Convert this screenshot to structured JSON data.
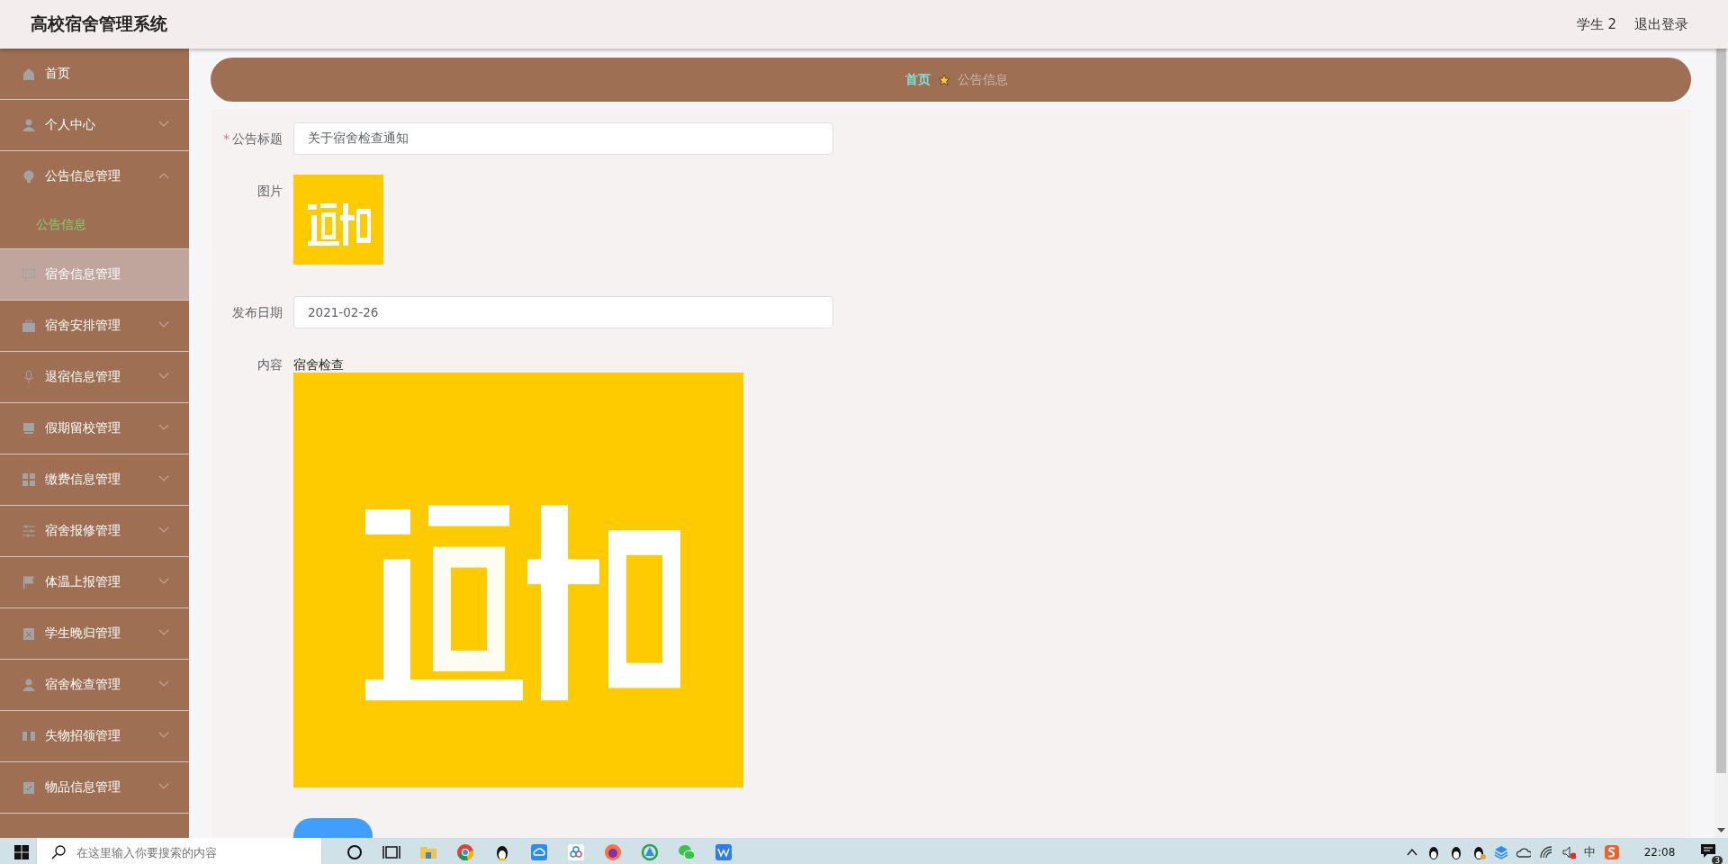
{
  "header": {
    "title": "高校宿舍管理系统",
    "user": "学生 2",
    "logout": "退出登录"
  },
  "sidebar": {
    "items": [
      {
        "kind": "link",
        "label": "首页",
        "hovered": false
      },
      {
        "kind": "menu",
        "label": "个人中心",
        "expanded": false,
        "hovered": false
      },
      {
        "kind": "menu",
        "label": "公告信息管理",
        "expanded": true,
        "hovered": false,
        "children": [
          {
            "label": "公告信息",
            "selected": true
          }
        ]
      },
      {
        "kind": "menu",
        "label": "宿舍信息管理",
        "expanded": false,
        "hovered": true
      },
      {
        "kind": "menu",
        "label": "宿舍安排管理",
        "expanded": false,
        "hovered": false
      },
      {
        "kind": "menu",
        "label": "退宿信息管理",
        "expanded": false,
        "hovered": false
      },
      {
        "kind": "menu",
        "label": "假期留校管理",
        "expanded": false,
        "hovered": false
      },
      {
        "kind": "menu",
        "label": "缴费信息管理",
        "expanded": false,
        "hovered": false
      },
      {
        "kind": "menu",
        "label": "宿舍报修管理",
        "expanded": false,
        "hovered": false
      },
      {
        "kind": "menu",
        "label": "体温上报管理",
        "expanded": false,
        "hovered": false
      },
      {
        "kind": "menu",
        "label": "学生晚归管理",
        "expanded": false,
        "hovered": false
      },
      {
        "kind": "menu",
        "label": "宿舍检查管理",
        "expanded": false,
        "hovered": false
      },
      {
        "kind": "menu",
        "label": "失物招领管理",
        "expanded": false,
        "hovered": false
      },
      {
        "kind": "menu",
        "label": "物品信息管理",
        "expanded": false,
        "hovered": false
      }
    ]
  },
  "breadcrumb": [
    {
      "label": "首页",
      "current": false
    },
    {
      "label": "公告信息",
      "current": true
    }
  ],
  "form": {
    "fields": [
      {
        "kind": "text",
        "label": "公告标题",
        "required_mark": "*",
        "value": "关于宿舍检查通知"
      },
      {
        "label": "图片"
      },
      {
        "kind": "text",
        "label": "发布日期",
        "value": "2021-02-26"
      },
      {
        "kind": "content",
        "label": "内容",
        "text": "宿舍检查"
      }
    ]
  },
  "taskbar": {
    "search_placeholder": "在这里输入你要搜索的内容",
    "ime": "中",
    "time": "22:08",
    "notification_count": "3"
  }
}
